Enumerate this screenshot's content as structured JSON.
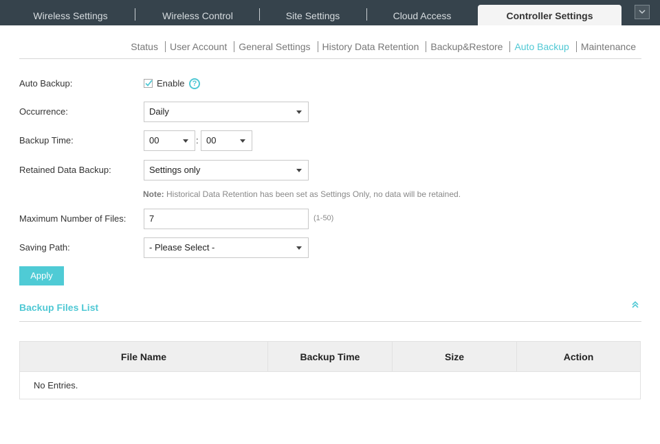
{
  "top_nav": {
    "tabs": [
      {
        "label": "Wireless Settings",
        "active": false
      },
      {
        "label": "Wireless Control",
        "active": false
      },
      {
        "label": "Site Settings",
        "active": false
      },
      {
        "label": "Cloud Access",
        "active": false
      },
      {
        "label": "Controller Settings",
        "active": true
      }
    ],
    "menu_icon": "chevron-down-icon"
  },
  "sub_nav": {
    "items": [
      {
        "label": "Status",
        "active": false
      },
      {
        "label": "User Account",
        "active": false
      },
      {
        "label": "General Settings",
        "active": false
      },
      {
        "label": "History Data Retention",
        "active": false
      },
      {
        "label": "Backup&Restore",
        "active": false
      },
      {
        "label": "Auto Backup",
        "active": true
      },
      {
        "label": "Maintenance",
        "active": false
      }
    ]
  },
  "form": {
    "auto_backup": {
      "label": "Auto Backup:",
      "checkbox_label": "Enable",
      "checked": true,
      "help_icon": "question-circle-icon",
      "help_glyph": "?"
    },
    "occurrence": {
      "label": "Occurrence:",
      "value": "Daily"
    },
    "backup_time": {
      "label": "Backup Time:",
      "hour": "00",
      "separator": ":",
      "minute": "00"
    },
    "retained_data": {
      "label": "Retained Data Backup:",
      "value": "Settings only"
    },
    "note": {
      "prefix": "Note:",
      "text": " Historical Data Retention has been set as Settings Only, no data will be retained."
    },
    "max_files": {
      "label": "Maximum Number of Files:",
      "value": "7",
      "range_hint": "(1-50)"
    },
    "saving_path": {
      "label": "Saving Path:",
      "value": "- Please Select -"
    },
    "apply_label": "Apply"
  },
  "backup_files": {
    "title": "Backup Files List",
    "collapse_icon": "double-chevron-up-icon",
    "columns": [
      "File Name",
      "Backup Time",
      "Size",
      "Action"
    ],
    "rows": [],
    "empty_text": "No Entries."
  },
  "colors": {
    "accent": "#4fc8d4",
    "topbar_bg": "#36434c",
    "active_tab_bg": "#f4f4f4"
  }
}
